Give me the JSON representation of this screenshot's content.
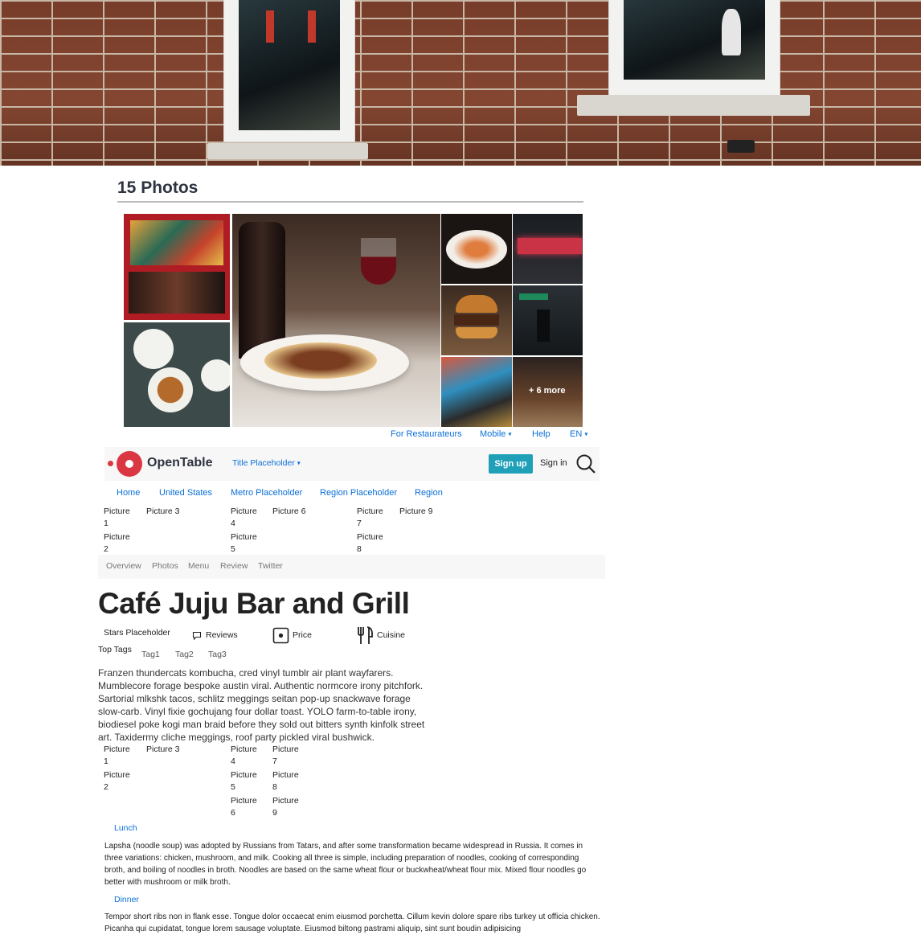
{
  "photos": {
    "title": "15 Photos",
    "more_label": "+ 6 more"
  },
  "utility_nav": {
    "for_restaurateurs": "For Restaurateurs",
    "mobile": "Mobile",
    "help": "Help",
    "language": "EN"
  },
  "navbar": {
    "logo_text": "OpenTable",
    "title_dropdown": "Title Placeholder",
    "signup": "Sign up",
    "signin": "Sign in"
  },
  "breadcrumb": [
    "Home",
    "United States",
    "Metro Placeholder",
    "Region Placeholder",
    "Region"
  ],
  "picture_grid_1": [
    "Picture 1",
    "Picture 2",
    "Picture 3",
    "Picture 4",
    "Picture 5",
    "Picture 6",
    "Picture 7",
    "Picture 8",
    "Picture 9"
  ],
  "subnav": [
    "Overview",
    "Photos",
    "Menu",
    "Review",
    "Twitter"
  ],
  "restaurant": {
    "name": "Café Juju Bar and Grill",
    "stars": "Stars Placeholder",
    "reviews": "Reviews",
    "price": "Price",
    "cuisine": "Cuisine",
    "top_tags_label": "Top Tags",
    "tags": [
      "Tag1",
      "Tag2",
      "Tag3"
    ],
    "description": "Franzen thundercats kombucha, cred vinyl tumblr air plant wayfarers. Mumblecore forage bespoke austin viral. Authentic normcore irony pitchfork. Sartorial mlkshk tacos, schlitz meggings seitan pop-up snackwave forage slow-carb. Vinyl fixie gochujang four dollar toast. YOLO farm-to-table irony, biodiesel poke kogi man braid before they sold out bitters synth kinfolk street art. Taxidermy cliche meggings, roof party pickled viral bushwick."
  },
  "picture_grid_2": [
    "Picture 1",
    "Picture 2",
    "Picture 3",
    "Picture 4",
    "Picture 5",
    "Picture 6",
    "Picture 7",
    "Picture 8",
    "Picture 9"
  ],
  "menus": [
    {
      "label": "Lunch",
      "text": "Lapsha (noodle soup) was adopted by Russians from Tatars, and after some transformation became widespread in Russia. It comes in three variations: chicken, mushroom, and milk. Cooking all three is simple, including preparation of noodles, cooking of corresponding broth, and boiling of noodles in broth. Noodles are based on the same wheat flour or buckwheat/wheat flour mix. Mixed flour noodles go better with mushroom or milk broth."
    },
    {
      "label": "Dinner",
      "text": "Tempor short ribs non in flank esse. Tongue dolor occaecat enim eiusmod porchetta. Cillum kevin dolore spare ribs turkey ut officia chicken. Picanha qui cupidatat, tongue lorem sausage voluptate. Eiusmod biltong pastrami aliquip, sint sunt boudin adipisicing"
    }
  ]
}
